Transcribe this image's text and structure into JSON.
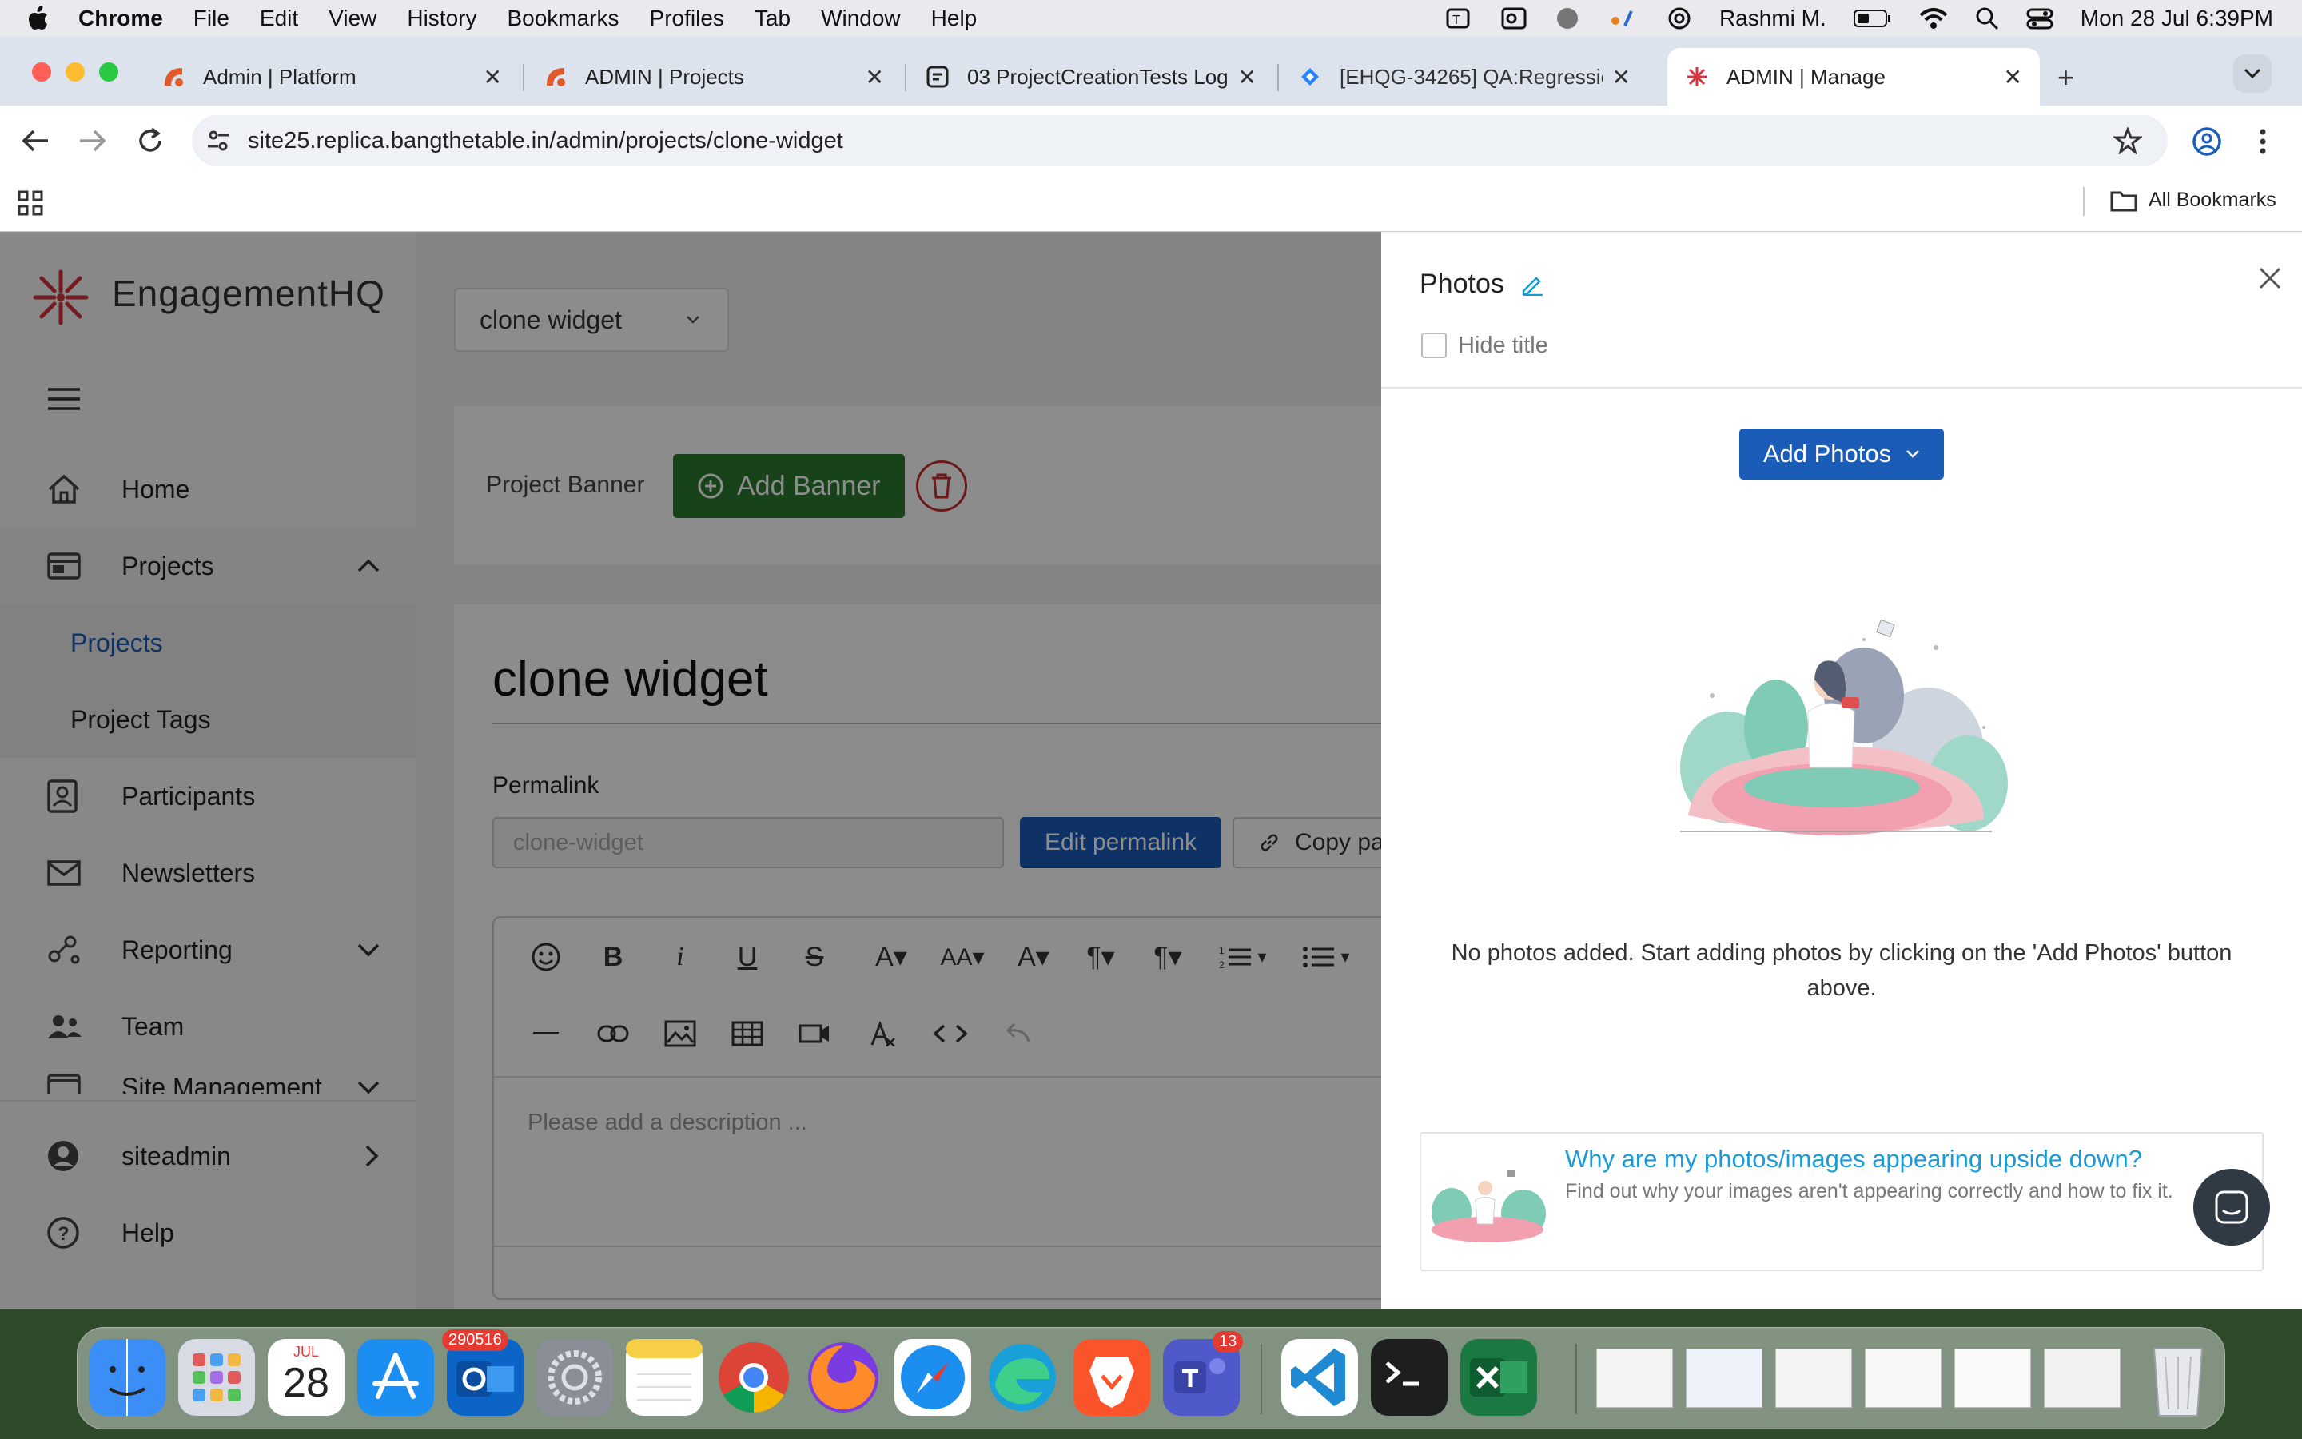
{
  "menubar": {
    "app": "Chrome",
    "items": [
      "File",
      "Edit",
      "View",
      "History",
      "Bookmarks",
      "Profiles",
      "Tab",
      "Window",
      "Help"
    ],
    "user": "Rashmi M.",
    "datetime": "Mon 28 Jul  6:39PM"
  },
  "tabs": [
    {
      "title": "Admin | Platform",
      "icon": "platform-favicon"
    },
    {
      "title": "ADMIN | Projects",
      "icon": "platform-favicon"
    },
    {
      "title": "03 ProjectCreationTests Log",
      "icon": "log-favicon"
    },
    {
      "title": "[EHQG-34265] QA:Regressio",
      "icon": "jira-favicon"
    },
    {
      "title": "ADMIN | Manage",
      "icon": "engagementhq-favicon",
      "active": true
    }
  ],
  "toolbar": {
    "url": "site25.replica.bangthetable.in/admin/projects/clone-widget",
    "all_bookmarks": "All Bookmarks"
  },
  "app": {
    "brand": "EngagementHQ",
    "project_selector": "clone widget",
    "nav": [
      {
        "label": "Home",
        "icon": "home-icon"
      },
      {
        "label": "Projects",
        "icon": "projects-icon",
        "expanded": true
      },
      {
        "label": "Participants",
        "icon": "participants-icon"
      },
      {
        "label": "Newsletters",
        "icon": "mail-icon"
      },
      {
        "label": "Reporting",
        "icon": "reporting-icon"
      },
      {
        "label": "Team",
        "icon": "team-icon"
      },
      {
        "label": "Site Management",
        "icon": "site-icon"
      }
    ],
    "subnav": [
      "Projects",
      "Project Tags"
    ],
    "user": "siteadmin",
    "help": "Help",
    "banner_label": "Project Banner",
    "add_banner": "Add Banner",
    "project_title": "clone widget",
    "permalink_label": "Permalink",
    "permalink_value": "clone-widget",
    "edit_permalink": "Edit permalink",
    "copy_page": "Copy pag",
    "description_placeholder": "Please add a description ..."
  },
  "drawer": {
    "title": "Photos",
    "hide_title": "Hide title",
    "add_photos": "Add Photos",
    "empty_message": "No photos added. Start adding photos by clicking on the 'Add Photos' button above.",
    "help_title": "Why are my photos/images appearing upside down?",
    "help_text": "Find out why your images aren't appearing correctly and how to fix it."
  },
  "dock": {
    "calendar_month": "JUL",
    "calendar_day": "28",
    "outlook_badge": "290516",
    "teams_badge": "13"
  },
  "colors": {
    "primary_blue": "#1a5cb8",
    "banner_green": "#2d7a30",
    "link_teal": "#1a9bd7",
    "brand_red": "#d6343f"
  }
}
